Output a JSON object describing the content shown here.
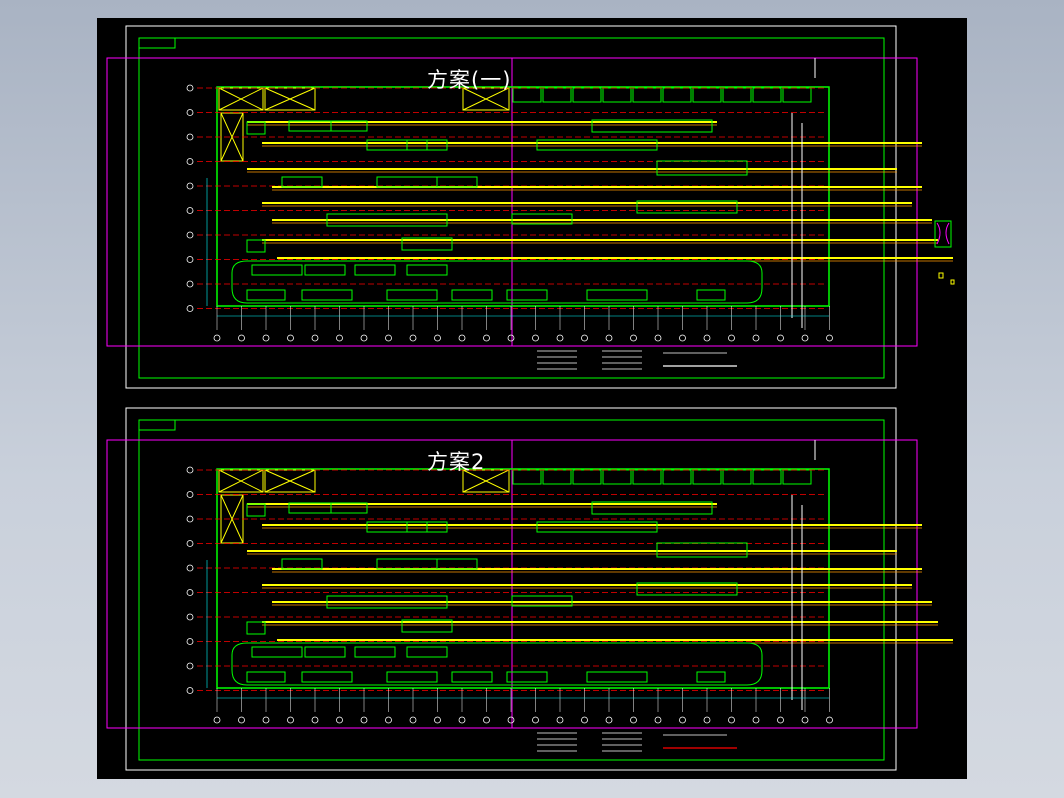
{
  "plans": [
    {
      "id": "plan-1",
      "title": "方案(一)"
    },
    {
      "id": "plan-2",
      "title": "方案2"
    }
  ],
  "colors": {
    "background": "#000000",
    "frame": "#ffffff",
    "border": "#00ff00",
    "viewport": "#ff00ff",
    "conveyor": "#ffff00",
    "axis": "#ff0000",
    "grid_circle": "#ffffff",
    "dimension": "#00ffff"
  }
}
